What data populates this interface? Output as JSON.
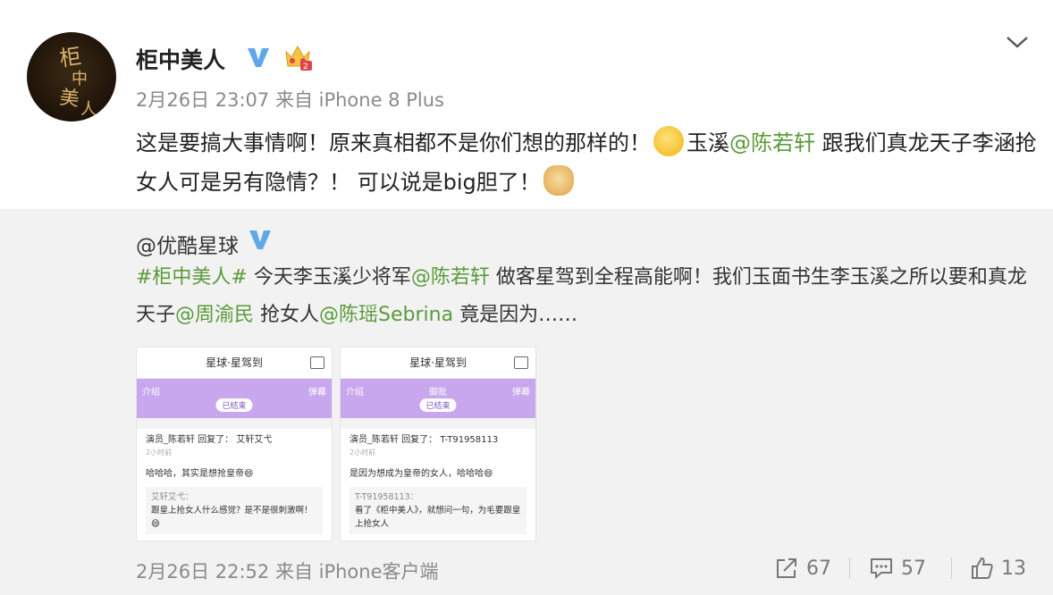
{
  "post": {
    "author": "柜中美人",
    "meta": "2月26日 23:07 来自 iPhone 8 Plus",
    "text1": "这是要搞大事情啊！原来真相都不是你们想的那样的！",
    "text2": "玉溪",
    "mention1": "@陈若轩",
    "text3": " 跟我们真龙天子李涵抢女人可是另有隐情？！ 可以说是big胆了！",
    "avatar_text": "柜中美人"
  },
  "repost": {
    "author": "@优酷星球",
    "hashtag": "#柜中美人#",
    "text_a": " 今天李玉溪少将军",
    "mention_a": "@陈若轩",
    "text_b": " 做客星驾到全程高能啊！我们玉面书生李玉溪之所以要和真龙天子",
    "mention_b": "@周渝民",
    "text_c": " 抢女人",
    "mention_c": "@陈瑶Sebrina",
    "text_d": " 竟是因为……",
    "footer_meta": "2月26日 22:52 来自 iPhone客户端",
    "repost_count": "67",
    "comment_count": "57",
    "like_count": "13"
  },
  "thumbs": [
    {
      "title": "星球·星驾到",
      "tab_left": "介绍",
      "tab_mid": "",
      "tab_right": "弹幕",
      "pill": "已结束",
      "comment_head": "演员_陈若轩  回复了：  艾轩艾弋",
      "comment_time": "2小时前",
      "comment_body": "哈哈哈，其实是想抢皇帝😄",
      "quote_name": "艾轩艾弋：",
      "quote_body": "跟皇上抢女人什么感觉？是不是很刺激啊！😄"
    },
    {
      "title": "星球·星驾到",
      "tab_left": "介绍",
      "tab_mid": "御批",
      "tab_right": "弹幕",
      "pill": "已结束",
      "comment_head": "演员_陈若轩  回复了：  T-T91958113",
      "comment_time": "2小时前",
      "comment_body": "是因为想成为皇帝的女人，哈哈哈😄",
      "quote_name": "T-T91958113：",
      "quote_body": "看了《柜中美人》，就想问一句，为毛要跟皇上抢女人"
    }
  ],
  "colors": {
    "link": "#5a9b3b",
    "vbadge": "#5fa8e8",
    "repost_bg": "#f2f2f2",
    "purple": "#c9a7ee"
  },
  "icons": [
    "verified-v-icon",
    "crown-level-icon",
    "chevron-down-icon",
    "grin-emoji-icon",
    "doge-emoji-icon",
    "share-icon",
    "comment-icon",
    "like-icon"
  ]
}
